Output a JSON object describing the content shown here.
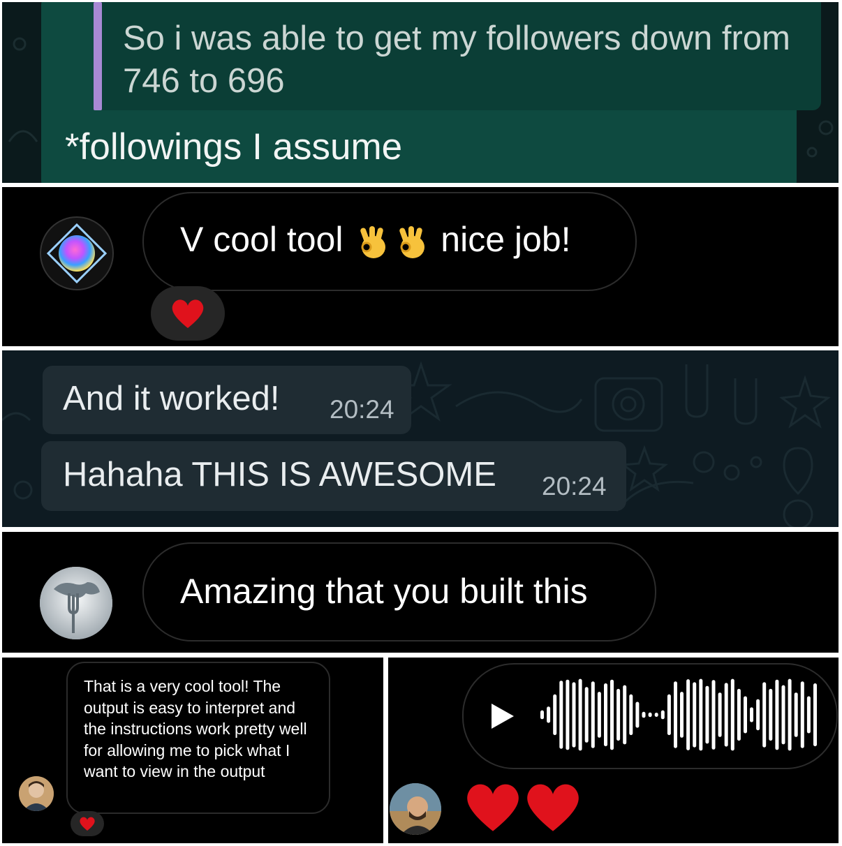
{
  "panel1": {
    "quoted_text": "So i was able to get my followers down from 746 to 696",
    "message_text": "*followings I assume"
  },
  "panel2": {
    "message_text_before": "V cool tool",
    "emojis": [
      "ok-hand-emoji",
      "ok-hand-emoji"
    ],
    "message_text_after": "nice job!",
    "reaction": "heart-emoji"
  },
  "panel3": {
    "messages": [
      {
        "text": "And it worked!",
        "time": "20:24"
      },
      {
        "text": "Hahaha THIS IS AWESOME",
        "time": "20:24"
      }
    ]
  },
  "panel4": {
    "message_text": "Amazing that you built this"
  },
  "panel5": {
    "message_text": "That is a very cool tool! The output is easy to interpret and the instructions work pretty well for allowing me to pick what I want to view in the output",
    "reaction": "heart-emoji"
  },
  "panel6": {
    "voice_message": "play-icon",
    "waveform_levels": [
      0.12,
      0.22,
      0.55,
      0.92,
      0.95,
      0.88,
      0.97,
      0.75,
      0.9,
      0.62,
      0.85,
      0.95,
      0.7,
      0.8,
      0.55,
      0.35,
      0.08,
      0.06,
      0.05,
      0.12,
      0.55,
      0.9,
      0.62,
      0.96,
      0.88,
      0.97,
      0.78,
      0.94,
      0.6,
      0.86,
      0.97,
      0.7,
      0.5,
      0.2,
      0.42,
      0.88,
      0.7,
      0.95,
      0.8,
      0.97,
      0.6,
      0.9,
      0.5,
      0.85
    ],
    "reactions": [
      "heart-emoji",
      "heart-emoji"
    ]
  },
  "colors": {
    "wa_outgoing_bubble": "#0e4a40",
    "wa_quote_bar": "#a889d4",
    "wa_incoming_bubble": "#1f2c33",
    "heart": "#e0121c"
  }
}
